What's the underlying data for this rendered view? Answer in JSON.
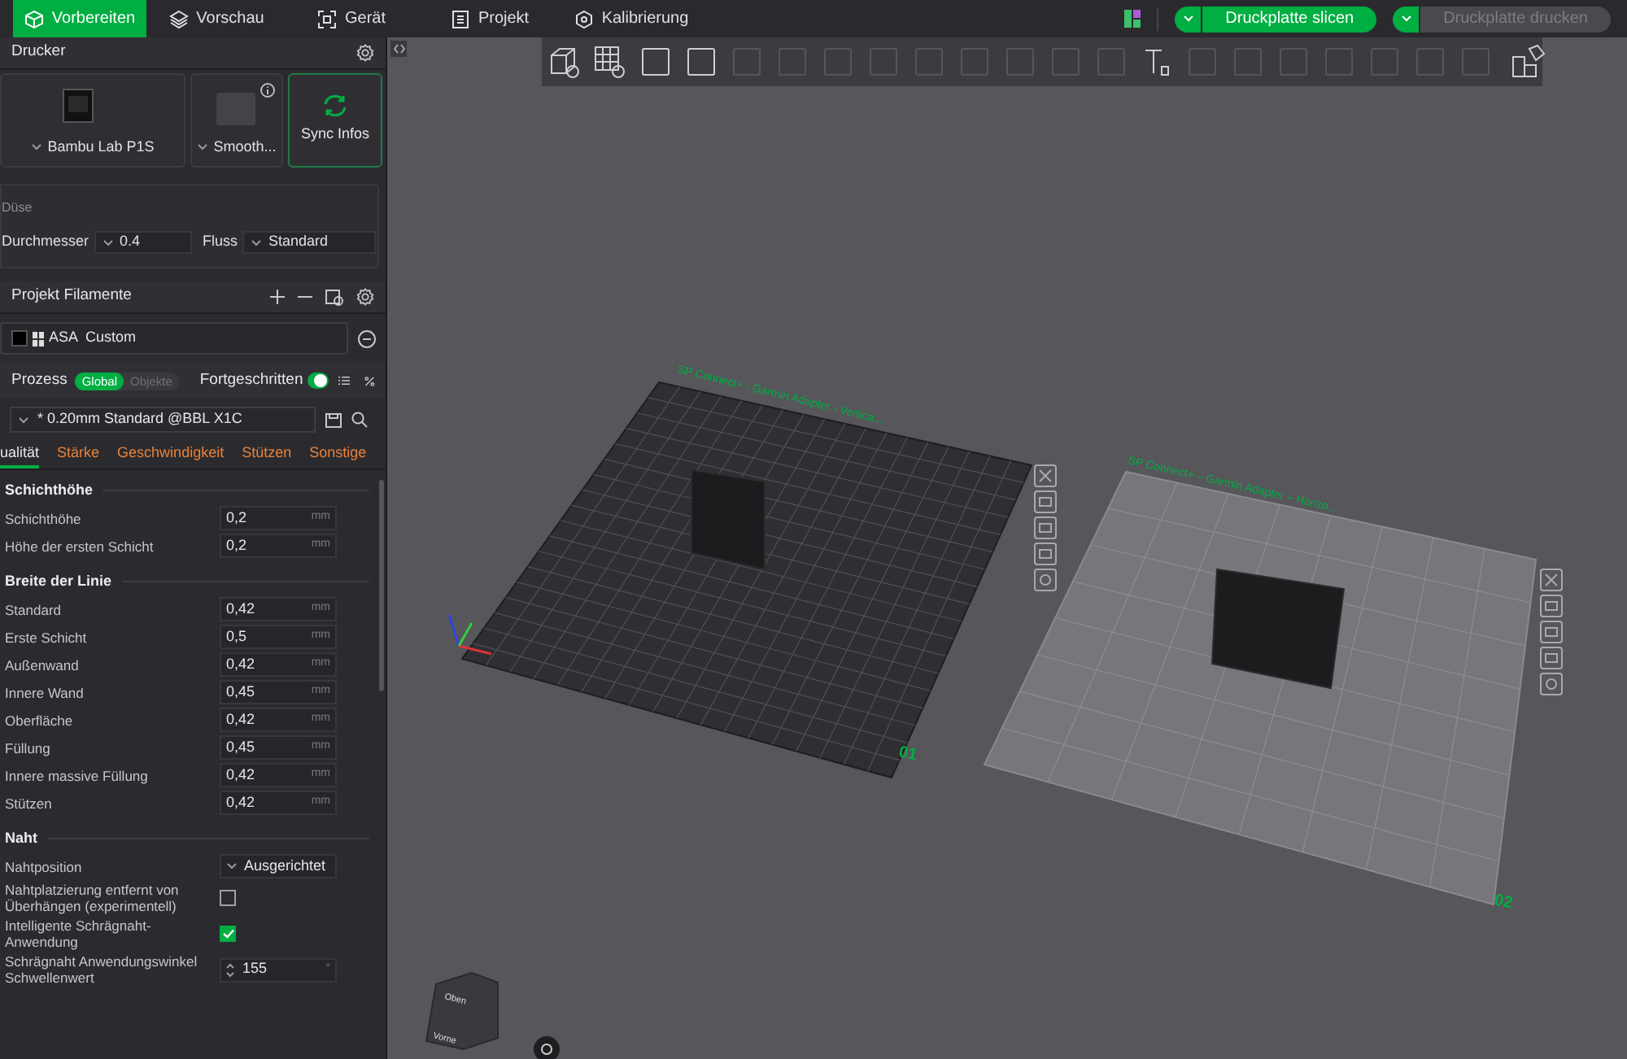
{
  "topbar": {
    "tabs": [
      {
        "label": "Vorbereiten",
        "kind": "prepare",
        "selected": true
      },
      {
        "label": "Vorschau",
        "kind": "preview",
        "selected": false
      },
      {
        "label": "Gerät",
        "kind": "device",
        "selected": false
      },
      {
        "label": "Projekt",
        "kind": "project",
        "selected": false
      },
      {
        "label": "Kalibrierung",
        "kind": "calibration",
        "selected": false
      }
    ],
    "actions": [
      {
        "label": "Druckplatte slicen",
        "disabled": false
      },
      {
        "label": "Druckplatte drucken",
        "disabled": true
      }
    ]
  },
  "printer": {
    "title": "Drucker",
    "cards": [
      {
        "label": "Bambu Lab P1S",
        "kind": "printer"
      },
      {
        "label": "Smooth...",
        "kind": "plate"
      }
    ],
    "sync": "Sync Infos",
    "nozzle": {
      "title": "Düse",
      "diameter_label": "Durchmesser",
      "diameter": "0.4",
      "flow_label": "Fluss",
      "flow": "Standard"
    }
  },
  "filaments": {
    "title": "Projekt Filamente",
    "items": [
      {
        "label": "ASA  Custom",
        "color": "#000000"
      }
    ]
  },
  "process": {
    "title": "Prozess",
    "scopes": [
      {
        "label": "Global",
        "selected": true
      },
      {
        "label": "Objekte",
        "selected": false
      }
    ],
    "advanced": {
      "label": "Fortgeschritten",
      "on": true
    },
    "preset": "* 0.20mm Standard @BBL X1C",
    "tabs": [
      {
        "label": "ualität",
        "selected": true
      },
      {
        "label": "Stärke",
        "selected": false
      },
      {
        "label": "Geschwindigkeit",
        "selected": false
      },
      {
        "label": "Stützen",
        "selected": false
      },
      {
        "label": "Sonstige",
        "selected": false
      }
    ],
    "sections": [
      {
        "title": "Schichthöhe",
        "rows": [
          {
            "kind": "number",
            "label": "Schichthöhe",
            "value": "0,2",
            "unit": "mm"
          },
          {
            "kind": "number",
            "label": "Höhe der ersten Schicht",
            "value": "0,2",
            "unit": "mm"
          }
        ]
      },
      {
        "title": "Breite der Linie",
        "rows": [
          {
            "kind": "number",
            "label": "Standard",
            "value": "0,42",
            "unit": "mm"
          },
          {
            "kind": "number",
            "label": "Erste Schicht",
            "value": "0,5",
            "unit": "mm"
          },
          {
            "kind": "number",
            "label": "Außenwand",
            "value": "0,42",
            "unit": "mm"
          },
          {
            "kind": "number",
            "label": "Innere Wand",
            "value": "0,45",
            "unit": "mm"
          },
          {
            "kind": "number",
            "label": "Oberfläche",
            "value": "0,42",
            "unit": "mm"
          },
          {
            "kind": "number",
            "label": "Füllung",
            "value": "0,45",
            "unit": "mm"
          },
          {
            "kind": "number",
            "label": "Innere massive Füllung",
            "value": "0,42",
            "unit": "mm"
          },
          {
            "kind": "number",
            "label": "Stützen",
            "value": "0,42",
            "unit": "mm"
          }
        ]
      },
      {
        "title": "Naht",
        "rows": [
          {
            "kind": "select",
            "label": "Nahtposition",
            "value": "Ausgerichtet"
          },
          {
            "kind": "checkbox",
            "label": "Nahtplatzierung entfernt von Überhängen (experimentell)",
            "checked": false
          },
          {
            "kind": "checkbox",
            "label": "Intelligente Schrägnaht-Anwendung",
            "checked": true
          },
          {
            "kind": "spinner",
            "label": "Schrägnaht Anwendungswinkel Schwellenwert",
            "value": "155",
            "unit": "°"
          }
        ]
      }
    ]
  },
  "viewport": {
    "plates": [
      {
        "name": "SP Connect+ - Garmin Adapter - Vertica...",
        "number": "01",
        "kind": "dark"
      },
      {
        "name": "SP Connect+ – Garmin Adapter – Horizo...",
        "number": "02",
        "kind": "light"
      }
    ],
    "view_cube": {
      "top": "Oben",
      "front": "Vorne"
    }
  }
}
